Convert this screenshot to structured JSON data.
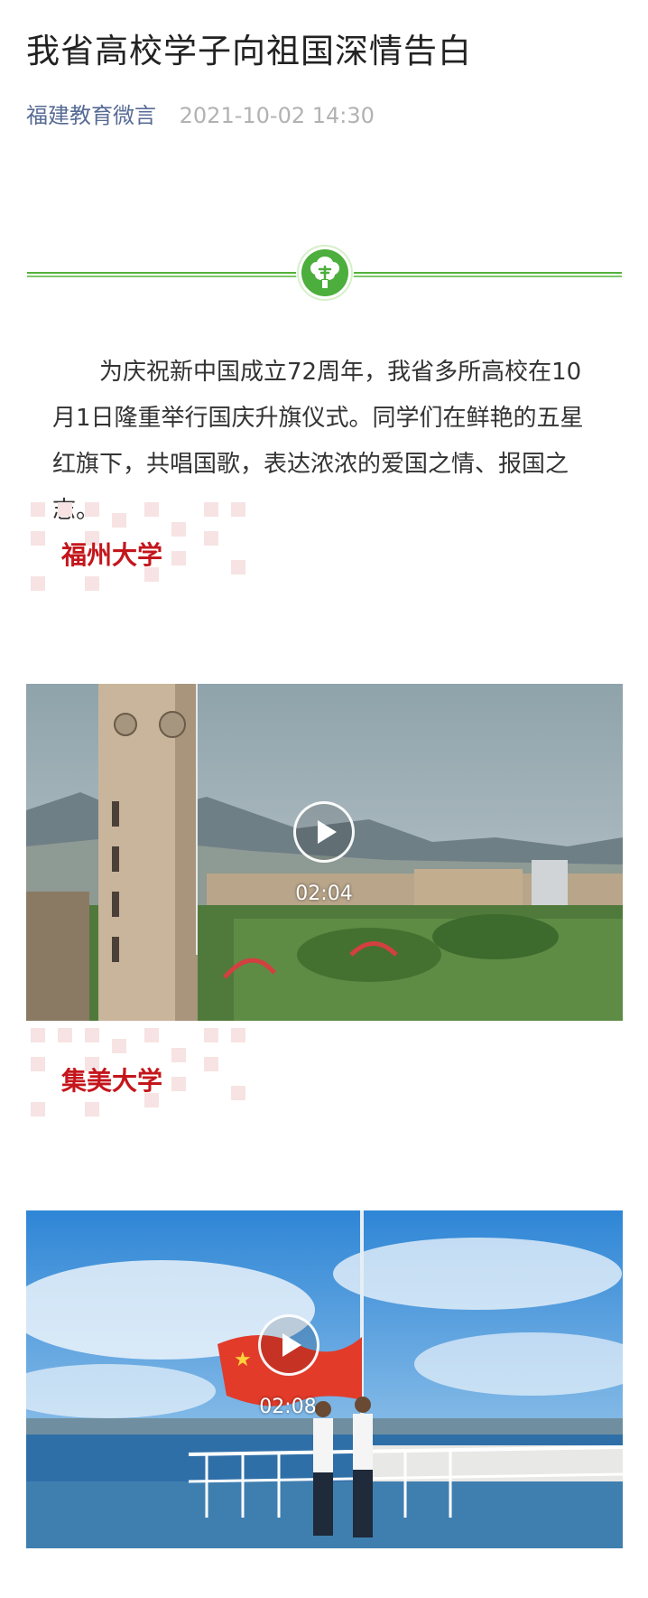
{
  "article": {
    "title": "我省高校学子向祖国深情告白",
    "author": "福建教育微言",
    "datetime": "2021-10-02 14:30",
    "intro": "为庆祝新中国成立72周年，我省多所高校在10月1日隆重举行国庆升旗仪式。同学们在鲜艳的五星红旗下，共唱国歌，表达浓浓的爱国之情、报国之志。"
  },
  "divider": {
    "icon": "tree-icon",
    "color": "#53b23b"
  },
  "sections": [
    {
      "label": "福州大学",
      "video": {
        "duration": "02:04",
        "scene": "campus-clock-tower"
      }
    },
    {
      "label": "集美大学",
      "video": {
        "duration": "02:08",
        "scene": "ship-flag-raising"
      }
    }
  ],
  "colors": {
    "accent": "#c4161c",
    "author": "#576b95",
    "meta": "#b2b2b2"
  }
}
